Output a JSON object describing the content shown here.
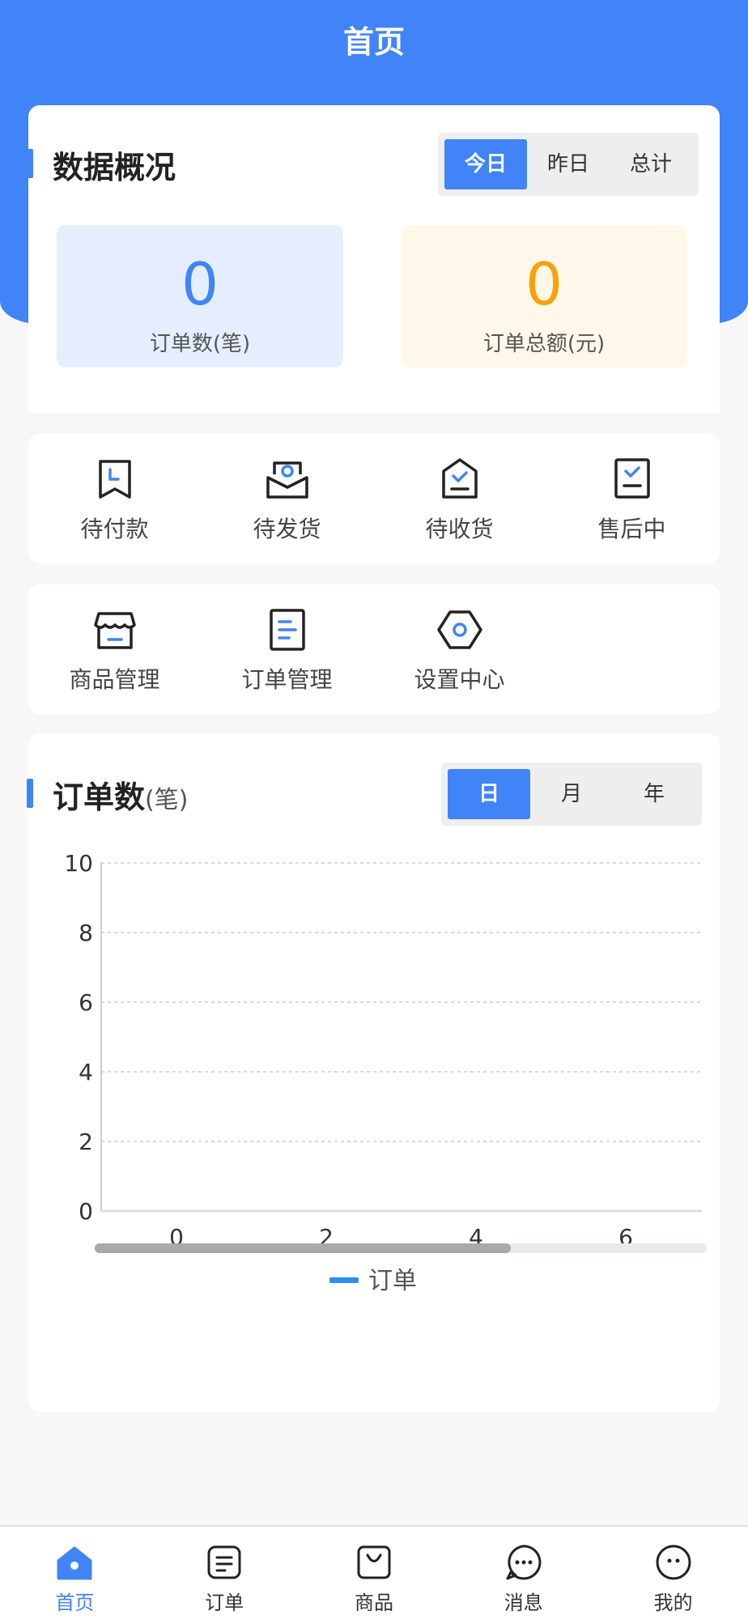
{
  "header": {
    "title": "首页"
  },
  "overview": {
    "title": "数据概况",
    "tabs": [
      "今日",
      "昨日",
      "总计"
    ],
    "active_tab": 0,
    "order_count": {
      "value": "0",
      "label": "订单数(笔)"
    },
    "order_amount": {
      "value": "0",
      "label": "订单总额(元)"
    }
  },
  "order_status": [
    {
      "label": "待付款",
      "icon": "pending-payment-icon"
    },
    {
      "label": "待发货",
      "icon": "pending-shipment-icon"
    },
    {
      "label": "待收货",
      "icon": "pending-receipt-icon"
    },
    {
      "label": "售后中",
      "icon": "after-sales-icon"
    }
  ],
  "management": [
    {
      "label": "商品管理",
      "icon": "store-icon"
    },
    {
      "label": "订单管理",
      "icon": "document-icon"
    },
    {
      "label": "设置中心",
      "icon": "settings-hexagon-icon"
    }
  ],
  "chart_section": {
    "title": "订单数",
    "unit": "(笔)",
    "tabs": [
      "日",
      "月",
      "年"
    ],
    "active_tab": 0
  },
  "chart_data": {
    "type": "line",
    "x_ticks": [
      "0",
      "2",
      "4",
      "6"
    ],
    "y_ticks": [
      "0",
      "2",
      "4",
      "6",
      "8",
      "10"
    ],
    "ylim": [
      0,
      10
    ],
    "grid": true,
    "legend": "bottom-center",
    "series": [
      {
        "name": "订单",
        "values": [],
        "color": "#2f8cf5"
      }
    ],
    "scroll_fraction": 0.68
  },
  "tabbar": {
    "items": [
      {
        "label": "首页",
        "icon": "home-icon"
      },
      {
        "label": "订单",
        "icon": "orders-icon"
      },
      {
        "label": "商品",
        "icon": "bag-icon"
      },
      {
        "label": "消息",
        "icon": "message-icon"
      },
      {
        "label": "我的",
        "icon": "profile-icon"
      }
    ],
    "active": 0
  },
  "colors": {
    "primary": "#4084f8",
    "orange": "#f7a20b",
    "chart_line": "#2f8cf5"
  }
}
